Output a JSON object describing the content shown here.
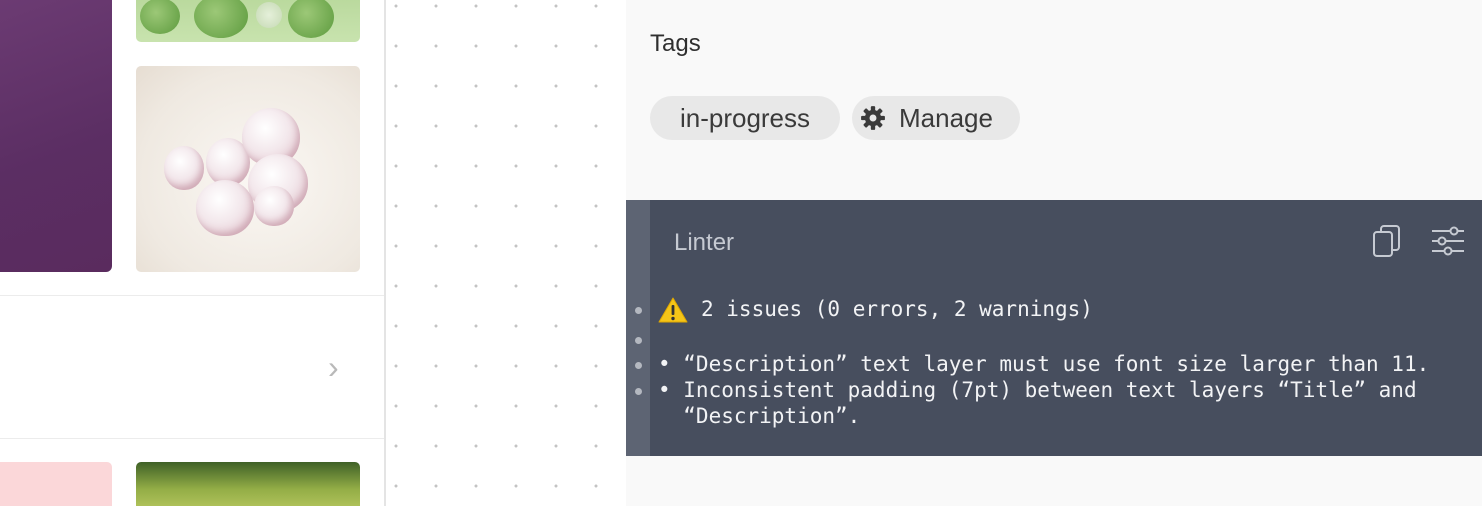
{
  "tags": {
    "title": "Tags",
    "items": [
      {
        "label": "in-progress"
      }
    ],
    "manage_label": "Manage"
  },
  "linter": {
    "title": "Linter",
    "summary": "2 issues (0 errors, 2 warnings)",
    "issues": [
      "• “Description” text layer must use font size larger than 11.",
      "• Inconsistent padding (7pt) between text layers “Title” and",
      "  “Description”."
    ]
  },
  "icons": {
    "manage": "gear-icon",
    "copy": "copy-icon",
    "settings": "sliders-icon",
    "warning": "warning-icon",
    "chevron": "chevron-right-icon"
  },
  "colors": {
    "linter_bg": "#474e5e",
    "chip_bg": "#e8e8e8",
    "warning": "#f5c518"
  }
}
